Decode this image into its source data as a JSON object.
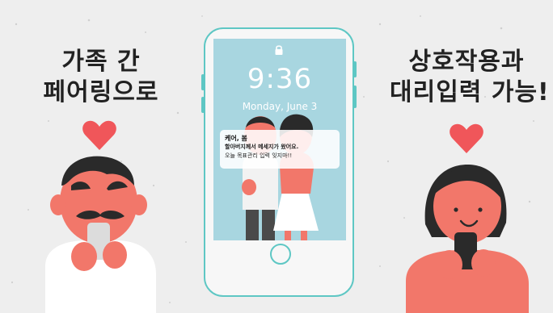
{
  "left_heading": {
    "line1": "가족 간",
    "line2": "페어링으로"
  },
  "right_heading": {
    "line1": "상호작용과",
    "line2": "대리입력 가능!"
  },
  "phone": {
    "time": "9:36",
    "date": "Monday, June 3",
    "notification": {
      "title": "케어, 봄",
      "line1": "할아버지께서 메세지가 왔어요.",
      "line2": "오늘 목표관리 입력 잊지마!!"
    }
  },
  "colors": {
    "background": "#eeeeee",
    "phone_outline": "#5ec7c4",
    "screen": "#a8d6e0",
    "heart": "#f0565a",
    "skin": "#f2776a"
  },
  "icons": [
    "heart-icon",
    "lock-icon",
    "home-button"
  ]
}
